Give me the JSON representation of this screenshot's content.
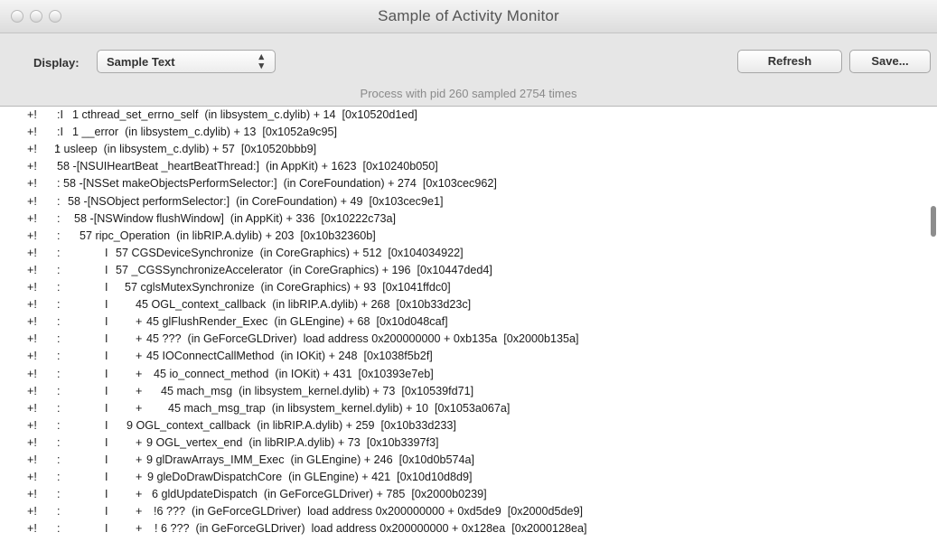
{
  "window": {
    "title": "Sample of Activity Monitor"
  },
  "toolbar": {
    "display_label": "Display:",
    "display_value": "Sample Text",
    "refresh_label": "Refresh",
    "save_label": "Save...",
    "process_info": "Process with pid 260 sampled 2754 times"
  },
  "sample_lines": [
    {
      "marker": "+!",
      "g1": ":I",
      "g2": "",
      "plus": "",
      "text": "1 cthread_set_errno_self  (in libsystem_c.dylib) + 14  [0x10520d1ed]"
    },
    {
      "marker": "+!",
      "g1": ":I",
      "g2": "",
      "plus": "",
      "text": "1 __error  (in libsystem_c.dylib) + 13  [0x1052a9c95]"
    },
    {
      "marker": "+!",
      "g1": ":",
      "g2": "",
      "plus": "",
      "text": "1 usleep  (in libsystem_c.dylib) + 57  [0x10520bbb9]"
    },
    {
      "marker": "+!",
      "g1": "",
      "g2": "",
      "plus": "",
      "text": "58 -[NSUIHeartBeat _heartBeatThread:]  (in AppKit) + 1623  [0x10240b050]"
    },
    {
      "marker": "+!",
      "g1": ":",
      "g2": "",
      "plus": "",
      "text": "58 -[NSSet makeObjectsPerformSelector:]  (in CoreFoundation) + 274  [0x103cec962]"
    },
    {
      "marker": "+!",
      "g1": ":",
      "g2": "",
      "plus": "",
      "text": "58 -[NSObject performSelector:]  (in CoreFoundation) + 49  [0x103cec9e1]"
    },
    {
      "marker": "+!",
      "g1": ":",
      "g2": "",
      "plus": "",
      "text": "58 -[NSWindow flushWindow]  (in AppKit) + 336  [0x10222c73a]"
    },
    {
      "marker": "+!",
      "g1": ":",
      "g2": "",
      "plus": "",
      "text": "57 ripc_Operation  (in libRIP.A.dylib) + 203  [0x10b32360b]"
    },
    {
      "marker": "+!",
      "g1": ":",
      "g2": "I",
      "plus": "",
      "text": "57 CGSDeviceSynchronize  (in CoreGraphics) + 512  [0x104034922]"
    },
    {
      "marker": "+!",
      "g1": ":",
      "g2": "I",
      "plus": "",
      "text": "57 _CGSSynchronizeAccelerator  (in CoreGraphics) + 196  [0x10447ded4]"
    },
    {
      "marker": "+!",
      "g1": ":",
      "g2": "I",
      "plus": "",
      "text": "57 cglsMutexSynchronize  (in CoreGraphics) + 93  [0x1041ffdc0]"
    },
    {
      "marker": "+!",
      "g1": ":",
      "g2": "I",
      "plus": "",
      "text": "45 OGL_context_callback  (in libRIP.A.dylib) + 268  [0x10b33d23c]"
    },
    {
      "marker": "+!",
      "g1": ":",
      "g2": "I",
      "plus": "+",
      "text": "45 glFlushRender_Exec  (in GLEngine) + 68  [0x10d048caf]"
    },
    {
      "marker": "+!",
      "g1": ":",
      "g2": "I",
      "plus": "+",
      "text": "45 ???  (in GeForceGLDriver)  load address 0x200000000 + 0xb135a  [0x2000b135a]"
    },
    {
      "marker": "+!",
      "g1": ":",
      "g2": "I",
      "plus": "+",
      "text": "45 IOConnectCallMethod  (in IOKit) + 248  [0x1038f5b2f]"
    },
    {
      "marker": "+!",
      "g1": ":",
      "g2": "I",
      "plus": "+",
      "text": "45 io_connect_method  (in IOKit) + 431  [0x10393e7eb]"
    },
    {
      "marker": "+!",
      "g1": ":",
      "g2": "I",
      "plus": "+",
      "text": "45 mach_msg  (in libsystem_kernel.dylib) + 73  [0x10539fd71]"
    },
    {
      "marker": "+!",
      "g1": ":",
      "g2": "I",
      "plus": "+",
      "text": "45 mach_msg_trap  (in libsystem_kernel.dylib) + 10  [0x1053a067a]"
    },
    {
      "marker": "+!",
      "g1": ":",
      "g2": "I",
      "plus": "",
      "text": "9 OGL_context_callback  (in libRIP.A.dylib) + 259  [0x10b33d233]"
    },
    {
      "marker": "+!",
      "g1": ":",
      "g2": "I",
      "plus": "+",
      "text": "9 OGL_vertex_end  (in libRIP.A.dylib) + 73  [0x10b3397f3]"
    },
    {
      "marker": "+!",
      "g1": ":",
      "g2": "I",
      "plus": "+",
      "text": "9 glDrawArrays_IMM_Exec  (in GLEngine) + 246  [0x10d0b574a]"
    },
    {
      "marker": "+!",
      "g1": ":",
      "g2": "I",
      "plus": "+",
      "text": "9 gleDoDrawDispatchCore  (in GLEngine) + 421  [0x10d10d8d9]"
    },
    {
      "marker": "+!",
      "g1": ":",
      "g2": "I",
      "plus": "+",
      "text": "6 gldUpdateDispatch  (in GeForceGLDriver) + 785  [0x2000b0239]"
    },
    {
      "marker": "+!",
      "g1": ":",
      "g2": "I",
      "plus": "+",
      "text": "!6 ???  (in GeForceGLDriver)  load address 0x200000000 + 0xd5de9  [0x2000d5de9]"
    },
    {
      "marker": "+!",
      "g1": ":",
      "g2": "I",
      "plus": "+",
      "text": "! 6 ???  (in GeForceGLDriver)  load address 0x200000000 + 0x128ea  [0x2000128ea]"
    }
  ]
}
